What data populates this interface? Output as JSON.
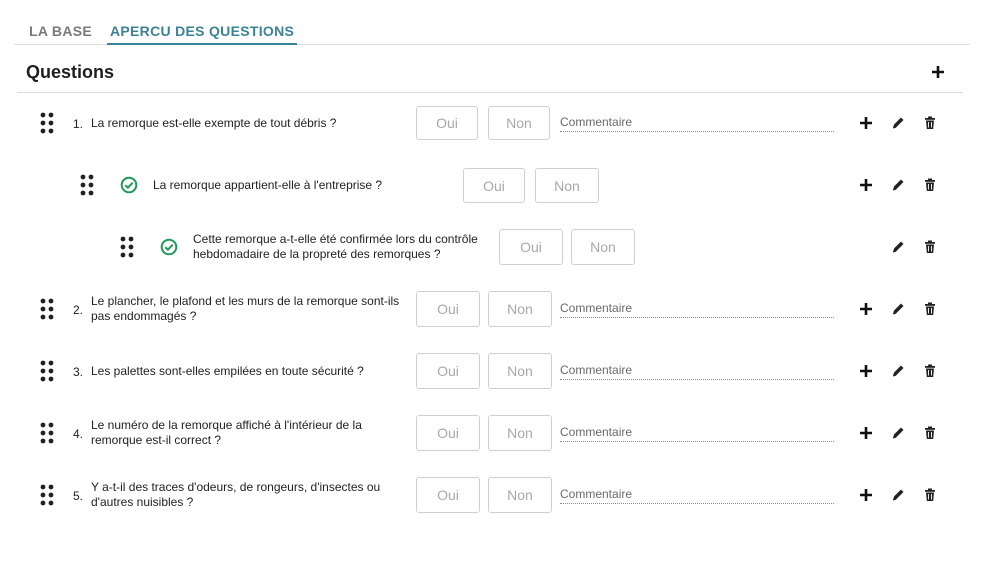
{
  "tabs": {
    "base": "LA BASE",
    "apercu": "APERCU DES QUESTIONS"
  },
  "header": {
    "title": "Questions"
  },
  "buttons": {
    "oui": "Oui",
    "non": "Non"
  },
  "comment_placeholder": "Commentaire",
  "colors": {
    "accent": "#3a8394",
    "check": "#1e9a57"
  },
  "questions": [
    {
      "number": "1.",
      "text": "La remorque est-elle exempte de tout débris ?"
    },
    {
      "number": "",
      "text": "La remorque appartient-elle à l'entreprise ?"
    },
    {
      "number": "",
      "text": "Cette remorque a-t-elle été confirmée lors du contrôle hebdomadaire de la propreté des remorques ?"
    },
    {
      "number": "2.",
      "text": "Le plancher, le plafond et les murs de la remorque sont-ils pas endommagés ?"
    },
    {
      "number": "3.",
      "text": "Les palettes sont-elles empilées en toute sécurité ?"
    },
    {
      "number": "4.",
      "text": "Le numéro de la remorque affiché à l'intérieur de la remorque est-il correct ?"
    },
    {
      "number": "5.",
      "text": "Y a-t-il des traces d'odeurs, de rongeurs, d'insectes ou d'autres nuisibles ?"
    }
  ]
}
